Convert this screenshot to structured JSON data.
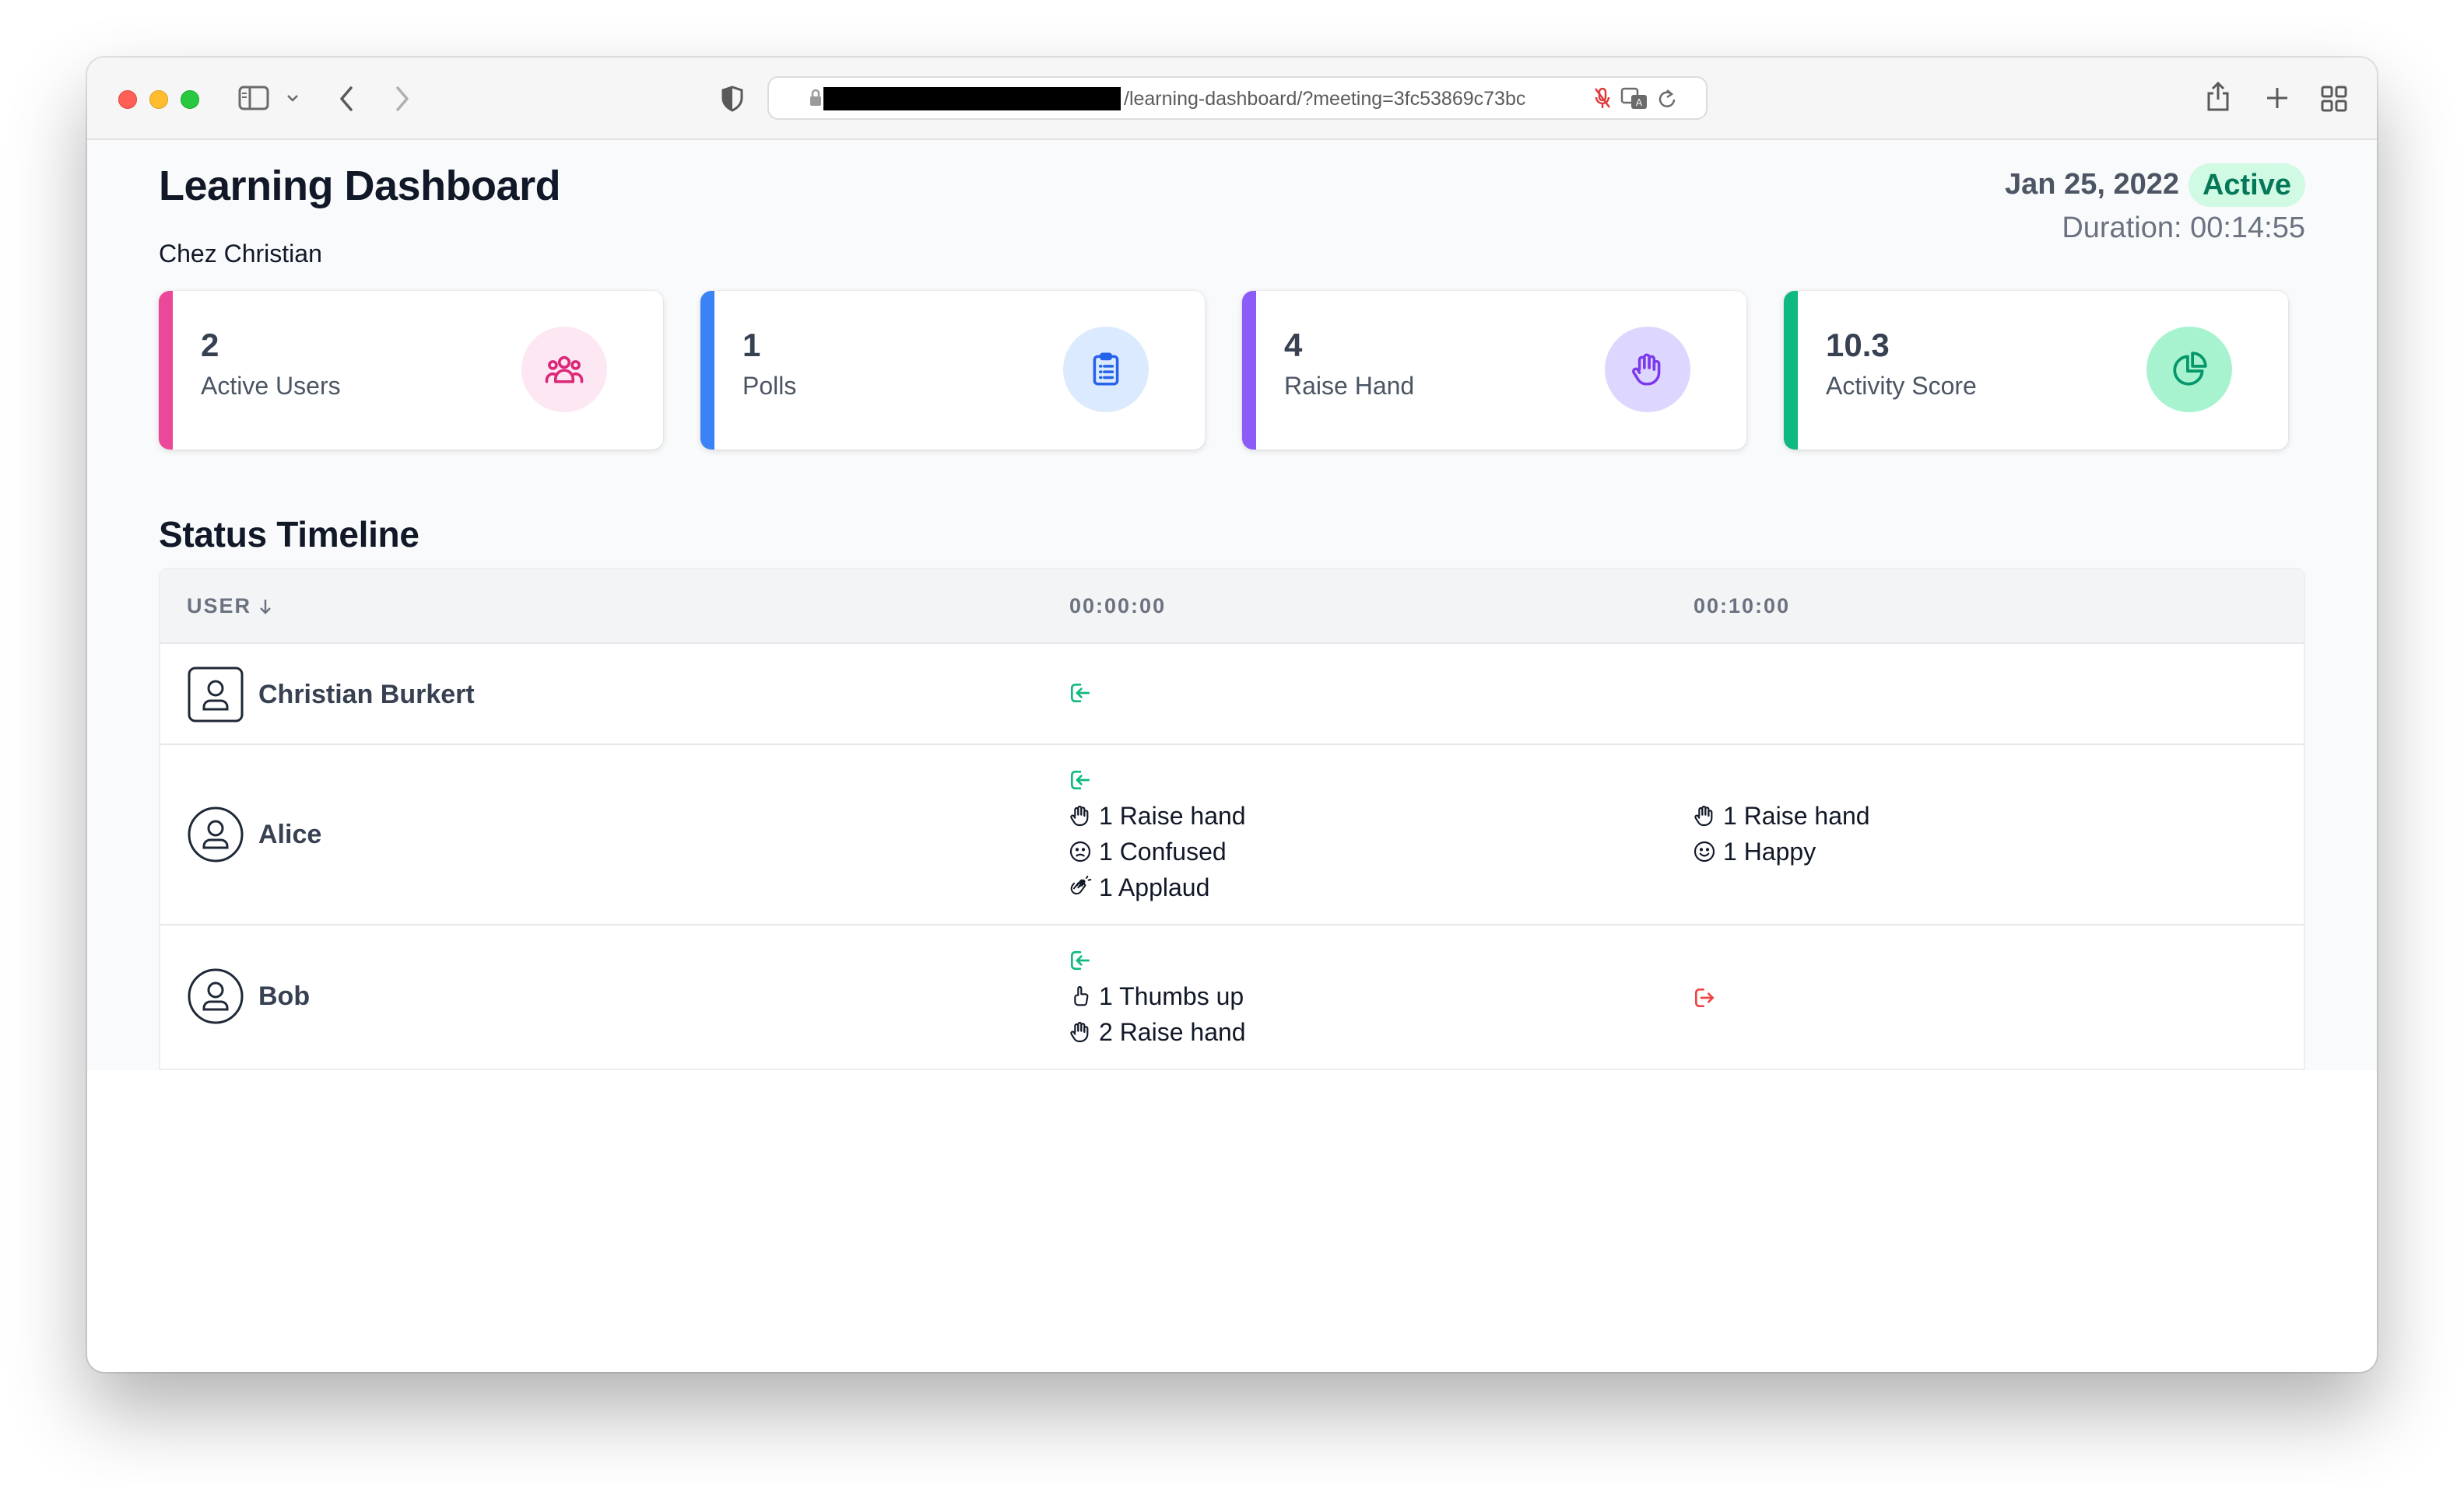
{
  "browser": {
    "url_visible": "/learning-dashboard/?meeting=3fc53869c73bc"
  },
  "header": {
    "title": "Learning Dashboard",
    "meeting_name": "Chez Christian",
    "date": "Jan 25, 2022",
    "status": "Active",
    "duration": "Duration: 00:14:55"
  },
  "cards": [
    {
      "value": "2",
      "label": "Active Users",
      "icon": "users-icon",
      "accent": "#ec4899",
      "bg": "#fce7f3"
    },
    {
      "value": "1",
      "label": "Polls",
      "icon": "clipboard-list-icon",
      "accent": "#3b82f6",
      "bg": "#dbeafe"
    },
    {
      "value": "4",
      "label": "Raise Hand",
      "icon": "hand-icon",
      "accent": "#8b5cf6",
      "bg": "#ddd6fe"
    },
    {
      "value": "10.3",
      "label": "Activity Score",
      "icon": "pie-chart-icon",
      "accent": "#10b981",
      "bg": "#a7f3d0"
    }
  ],
  "timeline": {
    "title": "Status Timeline",
    "columns": [
      "USER",
      "00:00:00",
      "00:10:00"
    ],
    "rows": [
      {
        "user": "Christian Burkert",
        "cells": [
          {
            "joined": true,
            "events": []
          },
          {
            "left": false,
            "events": []
          }
        ]
      },
      {
        "user": "Alice",
        "cells": [
          {
            "joined": true,
            "events": [
              {
                "icon": "hand-icon",
                "text": "1 Raise hand"
              },
              {
                "icon": "confused-face-icon",
                "text": "1 Confused"
              },
              {
                "icon": "applaud-icon",
                "text": "1 Applaud"
              }
            ]
          },
          {
            "left": false,
            "events": [
              {
                "icon": "hand-icon",
                "text": "1 Raise hand"
              },
              {
                "icon": "happy-face-icon",
                "text": "1 Happy"
              }
            ]
          }
        ]
      },
      {
        "user": "Bob",
        "cells": [
          {
            "joined": true,
            "events": [
              {
                "icon": "thumbs-up-icon",
                "text": "1 Thumbs up"
              },
              {
                "icon": "hand-icon",
                "text": "2 Raise hand"
              }
            ]
          },
          {
            "left": true,
            "events": []
          }
        ]
      }
    ]
  }
}
